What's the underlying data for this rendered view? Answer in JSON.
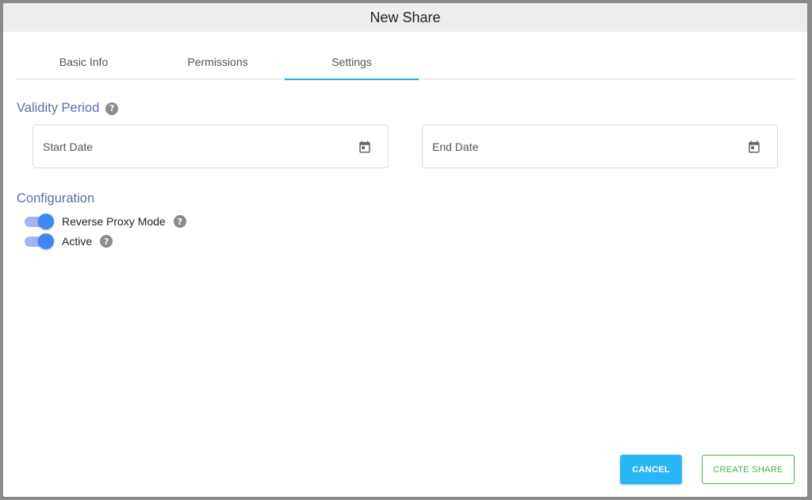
{
  "dialog": {
    "title": "New Share",
    "tabs": [
      {
        "label": "Basic Info",
        "active": false
      },
      {
        "label": "Permissions",
        "active": false
      },
      {
        "label": "Settings",
        "active": true
      }
    ],
    "validity": {
      "title": "Validity Period",
      "help_icon": "question-circle-icon",
      "start_placeholder": "Start Date",
      "end_placeholder": "End Date",
      "date_icon": "calendar-icon"
    },
    "configuration": {
      "title": "Configuration",
      "toggles": [
        {
          "label": "Reverse Proxy Mode",
          "on": true
        },
        {
          "label": "Active",
          "on": true
        }
      ]
    },
    "buttons": {
      "cancel": "CANCEL",
      "create": "CREATE SHARE"
    }
  },
  "colors": {
    "accent": "#29a8e0",
    "section_title": "#5a6fb0",
    "toggle_on": "#4285f4",
    "create": "#4caf50",
    "cancel_bg": "#29b6f6"
  }
}
